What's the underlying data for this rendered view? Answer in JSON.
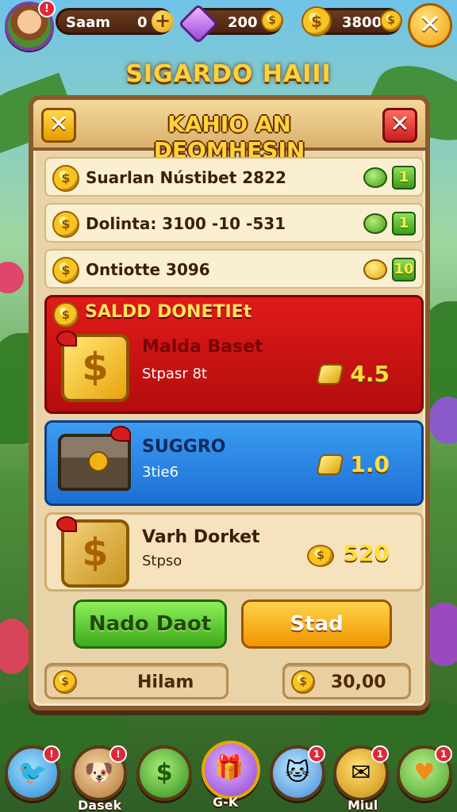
{
  "topbar": {
    "player_name": "Saam",
    "player_value": "0",
    "avatar_badge": "!",
    "gems": "200",
    "coins": "3800",
    "plus": "+",
    "close": "✕"
  },
  "screen_title": "SIGARDO HAIII",
  "panel": {
    "title": "KAHIO AN DEOMHESIN",
    "left_btn": "✕",
    "right_btn": "✕",
    "rows": [
      {
        "text": "Suarlan Nústibet 2822",
        "tag": "1"
      },
      {
        "text": "Dolinta: 3100 -10 -531",
        "tag": "1"
      },
      {
        "text": "Ontiotte 3096",
        "tag": "10"
      }
    ],
    "offers": {
      "red": {
        "title": "SALDD DONETIEt",
        "name": "Malda Baset",
        "sub": "Stpasr 8t",
        "price": "4.5"
      },
      "blue": {
        "name": "SUGGRO",
        "sub": "3tie6",
        "price": "1.0"
      },
      "cream": {
        "name": "Varh Dorket",
        "sub": "Stpso",
        "price": "520"
      }
    },
    "buttons": {
      "green": "Nado Daot",
      "orange": "Stad"
    },
    "fields": {
      "left": "Hilam",
      "right": "30,00"
    }
  },
  "navbar": {
    "items": [
      {
        "label": "",
        "badge": "!"
      },
      {
        "label": "Dasek",
        "badge": "!"
      },
      {
        "label": "",
        "badge": ""
      },
      {
        "label": "G-K",
        "badge": ""
      },
      {
        "label": "",
        "badge": "1"
      },
      {
        "label": "Miul",
        "badge": "1"
      },
      {
        "label": "",
        "badge": "1"
      }
    ]
  },
  "colors": {
    "accent_gold": "#ffd23a",
    "panel_bg": "#e9d3a8",
    "offer_red": "#e01a1a",
    "offer_blue": "#3b9df2",
    "btn_green": "#3eaa1a",
    "btn_orange": "#f09500"
  },
  "icons": [
    "avatar",
    "plus-icon",
    "gem-icon",
    "coin-icon",
    "close-icon",
    "cash-icon",
    "gift-icon",
    "chest-icon",
    "heart-icon"
  ]
}
